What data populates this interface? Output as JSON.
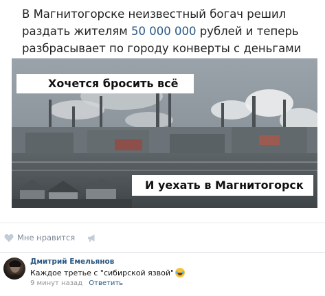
{
  "post": {
    "text_before": "В Магнитогорске неизвестный богач решил раздать жителям ",
    "amount": "50 000 000",
    "text_after": " рублей и теперь разбрасывает по городу конверты с деньгами"
  },
  "image": {
    "caption_top": "Хочется бросить всё",
    "caption_bottom": "И уехать в Магнитогорск"
  },
  "actions": {
    "like_label": "Мне нравится",
    "like_icon": "heart-icon",
    "share_icon": "megaphone-icon"
  },
  "comment": {
    "author": "Дмитрий Емельянов",
    "text": "Каждое третье с \"сибирской язвой\"",
    "emoji": "laughing-tears-emoji",
    "time": "9 минут назад",
    "reply_label": "Ответить"
  },
  "colors": {
    "link": "#2a5885",
    "meta": "#939393",
    "like_text": "#7c8a99"
  }
}
